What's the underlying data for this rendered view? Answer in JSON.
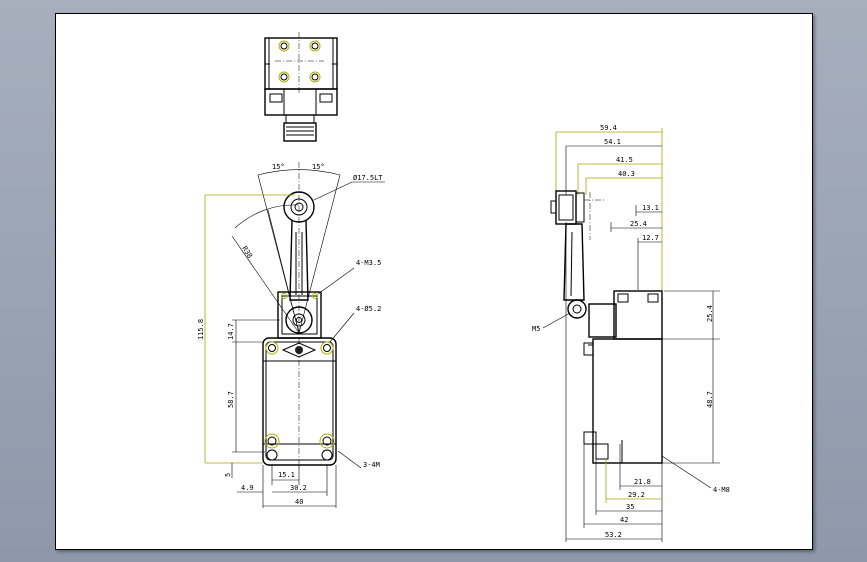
{
  "drawing": {
    "front_view": {
      "angle_left": "15°",
      "angle_right": "15°",
      "roller_dia": "Ø17.5LT",
      "arc_radius": "R38",
      "screw_label": "4-M3.5",
      "hole_label": "4-Ø5.2",
      "height_total": "115.8",
      "dim_14_7": "14.7",
      "dim_58_7": "58.7",
      "dim_5": "5",
      "mount_label": "3-4M",
      "dim_15_1": "15.1",
      "dim_4_9": "4.9",
      "dim_30_2": "30.2",
      "dim_40": "40"
    },
    "side_view": {
      "dim_59_4": "59.4",
      "dim_54_1": "54.1",
      "dim_41_5": "41.5",
      "dim_40_3": "40.3",
      "dim_13_1": "13.1",
      "dim_25_4": "25.4",
      "dim_12_7": "12.7",
      "m5_label": "M5",
      "dim_25_4v": "25.4",
      "dim_48_7": "48.7",
      "dim_21_8": "21.8",
      "dim_29_2": "29.2",
      "dim_35": "35",
      "dim_42": "42",
      "dim_53_2": "53.2",
      "mount_label": "4-M8"
    }
  }
}
